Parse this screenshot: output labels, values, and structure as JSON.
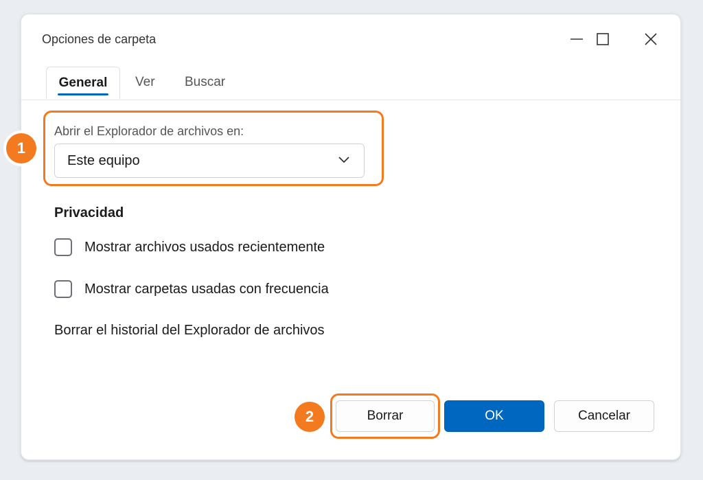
{
  "window": {
    "title": "Opciones de carpeta"
  },
  "tabs": [
    {
      "label": "General",
      "active": true
    },
    {
      "label": "Ver",
      "active": false
    },
    {
      "label": "Buscar",
      "active": false
    }
  ],
  "general": {
    "open_in_label": "Abrir el Explorador de archivos en:",
    "open_in_value": "Este equipo",
    "privacy_title": "Privacidad",
    "show_recent_files": {
      "label": "Mostrar archivos usados recientemente",
      "checked": false
    },
    "show_frequent_folders": {
      "label": "Mostrar carpetas usadas con frecuencia",
      "checked": false
    },
    "clear_history_label": "Borrar el historial del Explorador de archivos"
  },
  "buttons": {
    "clear": "Borrar",
    "ok": "OK",
    "cancel": "Cancelar"
  },
  "annotations": {
    "step1": "1",
    "step2": "2"
  },
  "colors": {
    "accent": "#0067c0",
    "highlight": "#f47a20",
    "background": "#eaedf1"
  }
}
